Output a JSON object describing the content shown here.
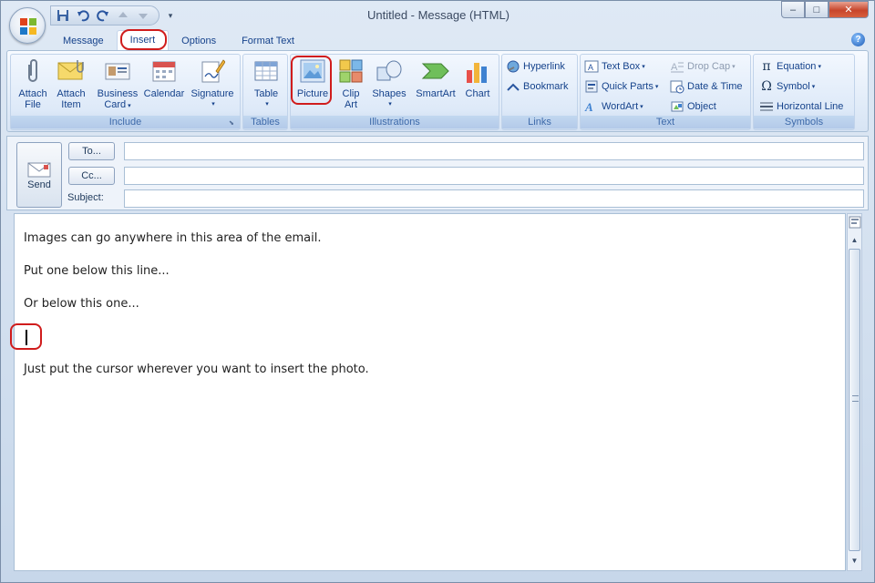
{
  "window": {
    "title": "Untitled - Message (HTML)",
    "controls": {
      "minimize": "–",
      "maximize": "□",
      "close": "✕"
    }
  },
  "quick_access": {
    "items": [
      "save-icon",
      "undo-icon",
      "redo-icon",
      "up-arrow-icon",
      "down-arrow-icon"
    ],
    "more": "▾"
  },
  "tabs": [
    "Message",
    "Insert",
    "Options",
    "Format Text"
  ],
  "active_tab": "Insert",
  "help": "?",
  "ribbon": {
    "include": {
      "label": "Include",
      "buttons": [
        {
          "line1": "Attach",
          "line2": "File",
          "icon": "paperclip-icon"
        },
        {
          "line1": "Attach",
          "line2": "Item",
          "icon": "envelope-icon"
        },
        {
          "line1": "Business",
          "line2": "Card",
          "icon": "business-card-icon",
          "dropdown": "▾"
        },
        {
          "line1": "Calendar",
          "line2": "",
          "icon": "calendar-icon"
        },
        {
          "line1": "Signature",
          "line2": "",
          "icon": "signature-icon",
          "dropdown": "▾"
        }
      ]
    },
    "tables": {
      "label": "Tables",
      "buttons": [
        {
          "line1": "Table",
          "line2": "",
          "icon": "table-icon",
          "dropdown": "▾"
        }
      ]
    },
    "illustrations": {
      "label": "Illustrations",
      "buttons": [
        {
          "line1": "Picture",
          "line2": "",
          "icon": "picture-icon"
        },
        {
          "line1": "Clip",
          "line2": "Art",
          "icon": "clip-art-icon"
        },
        {
          "line1": "Shapes",
          "line2": "",
          "icon": "shapes-icon",
          "dropdown": "▾"
        },
        {
          "line1": "SmartArt",
          "line2": "",
          "icon": "smartart-icon"
        },
        {
          "line1": "Chart",
          "line2": "",
          "icon": "chart-icon"
        }
      ]
    },
    "links": {
      "label": "Links",
      "buttons": [
        {
          "label": "Hyperlink",
          "icon": "hyperlink-icon"
        },
        {
          "label": "Bookmark",
          "icon": "bookmark-icon"
        }
      ]
    },
    "text": {
      "label": "Text",
      "buttons": [
        {
          "label": "Text Box",
          "icon": "text-box-icon",
          "dropdown": "▾"
        },
        {
          "label": "Quick Parts",
          "icon": "quick-parts-icon",
          "dropdown": "▾"
        },
        {
          "label": "WordArt",
          "icon": "wordart-icon",
          "dropdown": "▾"
        },
        {
          "label": "Drop Cap",
          "icon": "drop-cap-icon",
          "dropdown": "▾",
          "disabled": true
        },
        {
          "label": "Date & Time",
          "icon": "date-time-icon"
        },
        {
          "label": "Object",
          "icon": "object-icon"
        }
      ]
    },
    "symbols": {
      "label": "Symbols",
      "buttons": [
        {
          "label": "Equation",
          "icon": "equation-icon",
          "glyph": "π",
          "dropdown": "▾"
        },
        {
          "label": "Symbol",
          "icon": "symbol-icon",
          "glyph": "Ω",
          "dropdown": "▾"
        },
        {
          "label": "Horizontal Line",
          "icon": "horizontal-line-icon"
        }
      ]
    }
  },
  "compose": {
    "send_label": "Send",
    "to_label": "To...",
    "cc_label": "Cc...",
    "subject_label": "Subject:",
    "to_value": "",
    "cc_value": "",
    "subject_value": ""
  },
  "body": {
    "lines": [
      "Images can go anywhere in this area of the email.",
      "Put one below this line...",
      "Or below this one...",
      "Just put the cursor wherever you want to insert the photo."
    ]
  },
  "colors": {
    "highlight": "#d01c1c",
    "ribbon_text": "#15428b",
    "group_label": "#3e6aaa"
  }
}
